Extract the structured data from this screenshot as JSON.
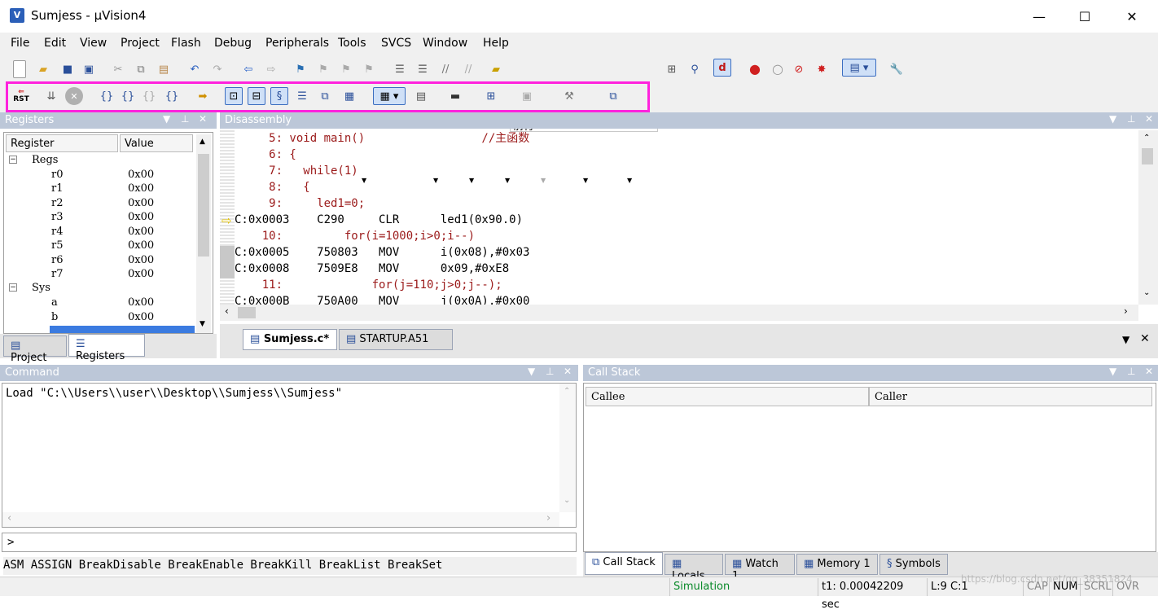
{
  "window": {
    "title": "Sumjess  - µVision4",
    "icon": "V",
    "controls": [
      "—",
      "☐",
      "✕"
    ]
  },
  "menu": [
    "File",
    "Edit",
    "View",
    "Project",
    "Flash",
    "Debug",
    "Peripherals",
    "Tools",
    "SVCS",
    "Window",
    "Help"
  ],
  "toolbar": {
    "find_value": "前行",
    "rst_label": "RST"
  },
  "registers_pane": {
    "title": "Registers",
    "col_register": "Register",
    "col_value": "Value",
    "groups": [
      {
        "name": "Regs",
        "items": [
          {
            "name": "r0",
            "value": "0x00"
          },
          {
            "name": "r1",
            "value": "0x00"
          },
          {
            "name": "r2",
            "value": "0x00"
          },
          {
            "name": "r3",
            "value": "0x00"
          },
          {
            "name": "r4",
            "value": "0x00"
          },
          {
            "name": "r5",
            "value": "0x00"
          },
          {
            "name": "r6",
            "value": "0x00"
          },
          {
            "name": "r7",
            "value": "0x00"
          }
        ]
      },
      {
        "name": "Sys",
        "items": [
          {
            "name": "a",
            "value": "0x00"
          },
          {
            "name": "b",
            "value": "0x00"
          }
        ]
      }
    ],
    "tabs": [
      "Project",
      "Registers"
    ]
  },
  "disassembly": {
    "title": "Disassembly",
    "lines": [
      {
        "kind": "src",
        "text": "     5: void main()                 //主函数"
      },
      {
        "kind": "src",
        "text": "     6: {"
      },
      {
        "kind": "src",
        "text": "     7:   while(1)"
      },
      {
        "kind": "src",
        "text": "     8:   {"
      },
      {
        "kind": "src",
        "text": "     9:     led1=0;"
      },
      {
        "kind": "asm",
        "text": "C:0x0003    C290     CLR      led1(0x90.0)"
      },
      {
        "kind": "src",
        "text": "    10:         for(i=1000;i>0;i--)"
      },
      {
        "kind": "asm",
        "text": "C:0x0005    750803   MOV      i(0x08),#0x03"
      },
      {
        "kind": "asm",
        "text": "C:0x0008    7509E8   MOV      0x09,#0xE8"
      },
      {
        "kind": "src",
        "text": "    11:             for(j=110;j>0;j--);"
      },
      {
        "kind": "asm",
        "text": "C:0x000B    750A00   MOV      j(0x0A),#0x00"
      }
    ]
  },
  "editor_tabs": [
    "Sumjess.c*",
    "STARTUP.A51"
  ],
  "command": {
    "title": "Command",
    "output": "Load \"C:\\\\Users\\\\user\\\\Desktop\\\\Sumjess\\\\Sumjess\"",
    "prompt": ">",
    "hints": "ASM ASSIGN BreakDisable BreakEnable BreakKill BreakList BreakSet"
  },
  "callstack": {
    "title": "Call Stack",
    "col_callee": "Callee",
    "col_caller": "Caller",
    "tabs": [
      "Call Stack",
      "Locals",
      "Watch 1",
      "Memory 1",
      "Symbols"
    ]
  },
  "status": {
    "mode": "Simulation",
    "time": "t1: 0.00042209 sec",
    "position": "L:9 C:1",
    "caps": "CAP",
    "num": "NUM",
    "scrl": "SCRL",
    "ovr": "OVR",
    "watermark": "https://blog.csdn.net/qq_38351824"
  }
}
